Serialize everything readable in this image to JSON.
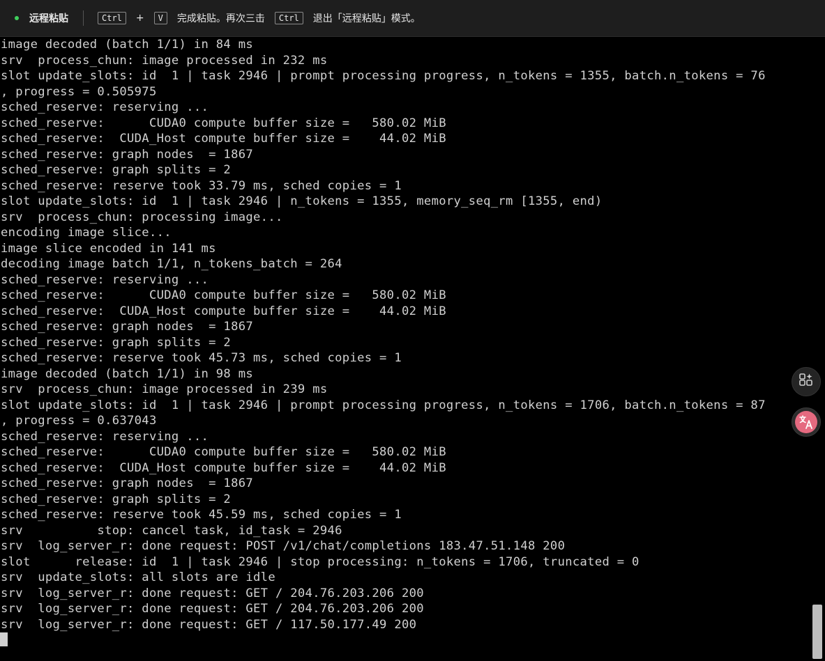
{
  "topbar": {
    "title": "远程粘贴",
    "key_ctrl": "Ctrl",
    "plus": "+",
    "key_v": "V",
    "hint_paste": "完成粘贴。再次三击",
    "key_ctrl_again": "Ctrl",
    "hint_exit": "退出「远程粘贴」模式。",
    "status_color": "#3fcf5c"
  },
  "terminal": {
    "lines": [
      "image decoded (batch 1/1) in 84 ms",
      "srv  process_chun: image processed in 232 ms",
      "slot update_slots: id  1 | task 2946 | prompt processing progress, n_tokens = 1355, batch.n_tokens = 76",
      ", progress = 0.505975",
      "sched_reserve: reserving ...",
      "sched_reserve:      CUDA0 compute buffer size =   580.02 MiB",
      "sched_reserve:  CUDA_Host compute buffer size =    44.02 MiB",
      "sched_reserve: graph nodes  = 1867",
      "sched_reserve: graph splits = 2",
      "sched_reserve: reserve took 33.79 ms, sched copies = 1",
      "slot update_slots: id  1 | task 2946 | n_tokens = 1355, memory_seq_rm [1355, end)",
      "srv  process_chun: processing image...",
      "encoding image slice...",
      "image slice encoded in 141 ms",
      "decoding image batch 1/1, n_tokens_batch = 264",
      "sched_reserve: reserving ...",
      "sched_reserve:      CUDA0 compute buffer size =   580.02 MiB",
      "sched_reserve:  CUDA_Host compute buffer size =    44.02 MiB",
      "sched_reserve: graph nodes  = 1867",
      "sched_reserve: graph splits = 2",
      "sched_reserve: reserve took 45.73 ms, sched copies = 1",
      "image decoded (batch 1/1) in 98 ms",
      "srv  process_chun: image processed in 239 ms",
      "slot update_slots: id  1 | task 2946 | prompt processing progress, n_tokens = 1706, batch.n_tokens = 87",
      ", progress = 0.637043",
      "sched_reserve: reserving ...",
      "sched_reserve:      CUDA0 compute buffer size =   580.02 MiB",
      "sched_reserve:  CUDA_Host compute buffer size =    44.02 MiB",
      "sched_reserve: graph nodes  = 1867",
      "sched_reserve: graph splits = 2",
      "sched_reserve: reserve took 45.59 ms, sched copies = 1",
      "srv          stop: cancel task, id_task = 2946",
      "srv  log_server_r: done request: POST /v1/chat/completions 183.47.51.148 200",
      "slot      release: id  1 | task 2946 | stop processing: n_tokens = 1706, truncated = 0",
      "srv  update_slots: all slots are idle",
      "srv  log_server_r: done request: GET / 204.76.203.206 200",
      "srv  log_server_r: done request: GET / 204.76.203.206 200",
      "srv  log_server_r: done request: GET / 117.50.177.49 200"
    ],
    "text_color": "#d0d0d0",
    "background": "#000000"
  },
  "floating": {
    "apps_icon": "apps-sparkle-icon",
    "translate_icon": "translate-icon",
    "translate_color": "#e56a80"
  }
}
